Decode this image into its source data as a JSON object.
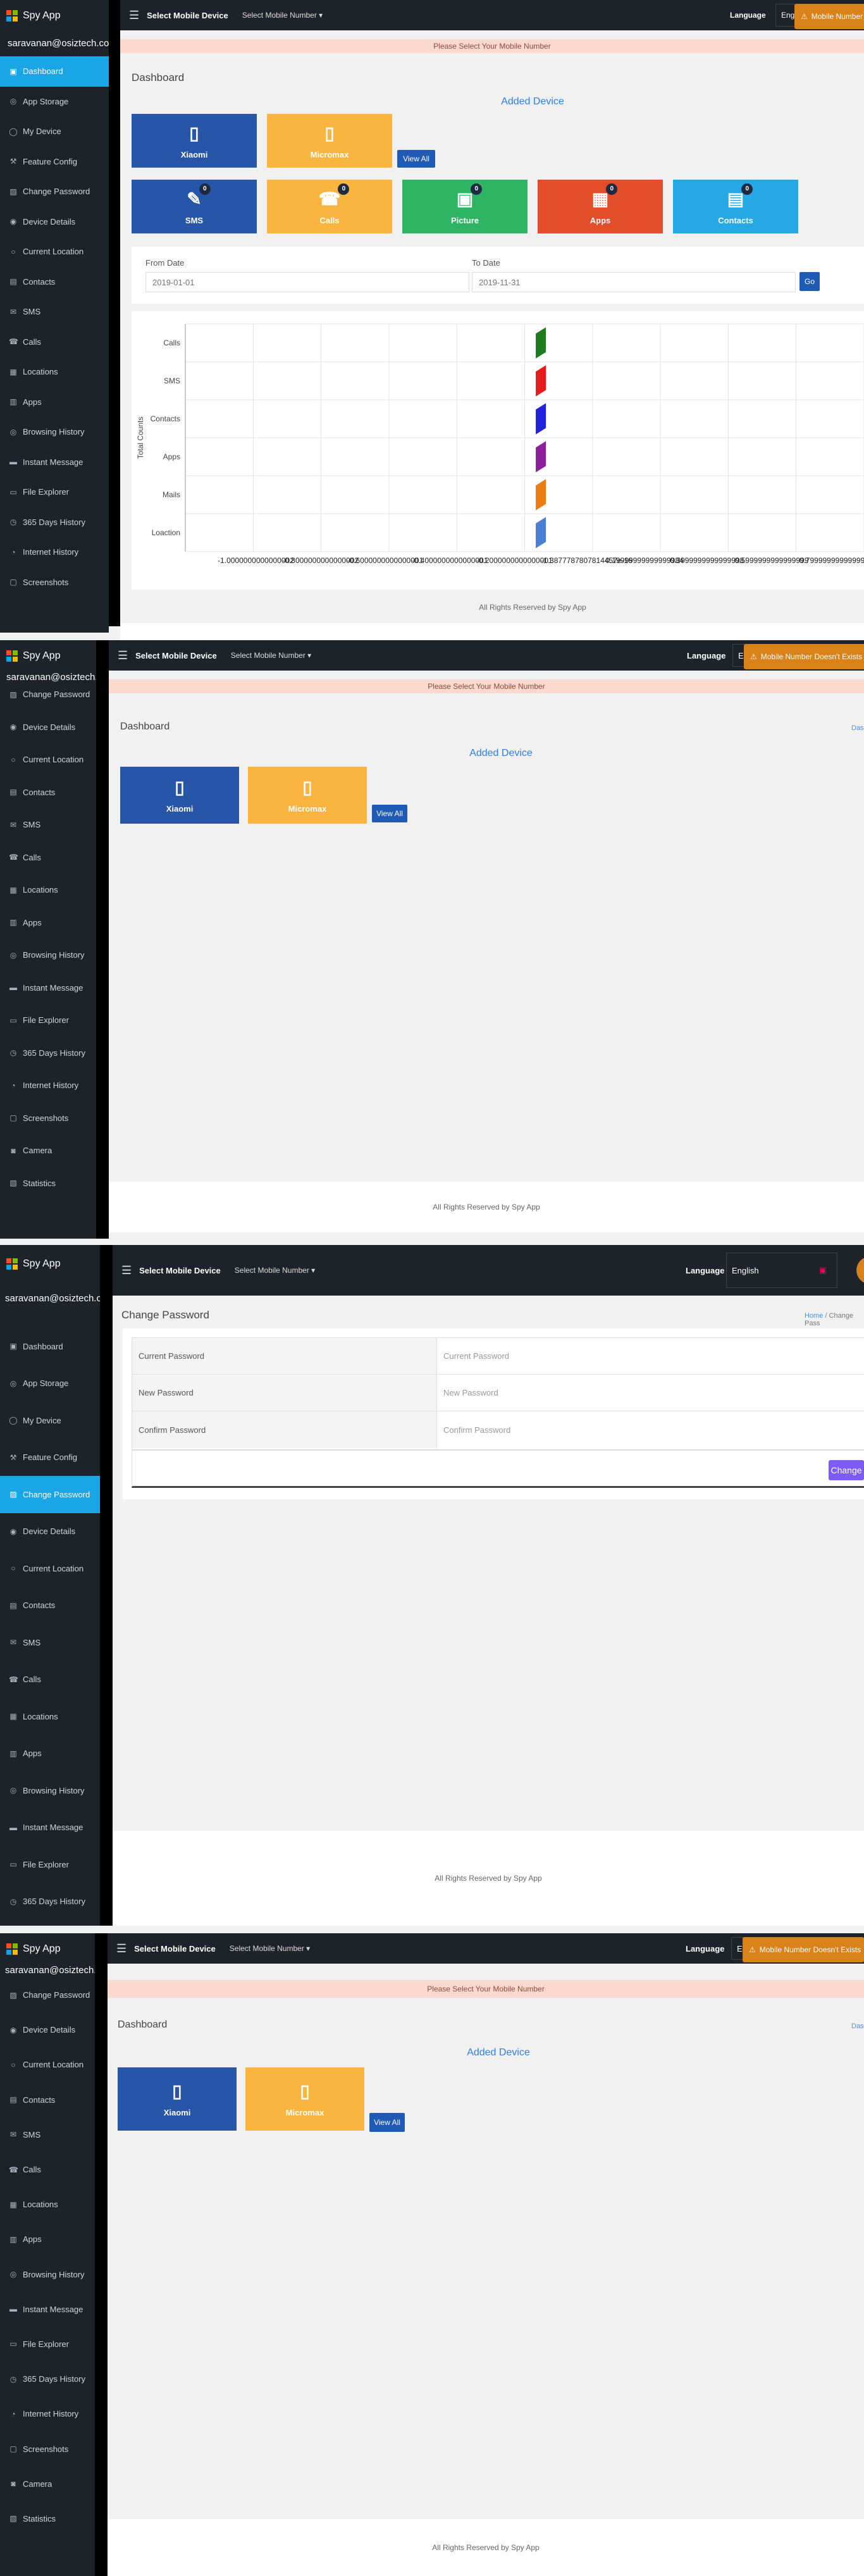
{
  "app": {
    "name": "Spy App",
    "email": "saravanan@osiztech.com",
    "footer": "All Rights Reserved by Spy App"
  },
  "topbar": {
    "menu_icon": "hamburger-icon",
    "title": "Select Mobile Device",
    "selector": "Select Mobile Number ▾",
    "language_label": "Language",
    "language_value": "English",
    "language_short": "Engl",
    "toast_1": "Mobile Number",
    "toast_2": "Mobile Number Doesn't Exists",
    "toast_icon": "warning-icon"
  },
  "alert": "Please Select Your Mobile Number",
  "nav_full": [
    {
      "label": "Dashboard",
      "icon": "dashboard-icon",
      "glyph": "▣"
    },
    {
      "label": "App Storage",
      "icon": "storage-icon",
      "glyph": "◎"
    },
    {
      "label": "My Device",
      "icon": "device-icon",
      "glyph": "◯"
    },
    {
      "label": "Feature Config",
      "icon": "wrench-icon",
      "glyph": "⚒"
    },
    {
      "label": "Change Password",
      "icon": "lock-icon",
      "glyph": "▨"
    },
    {
      "label": "Device Details",
      "icon": "info-icon",
      "glyph": "◉"
    },
    {
      "label": "Current Location",
      "icon": "location-icon",
      "glyph": "○"
    },
    {
      "label": "Contacts",
      "icon": "contacts-icon",
      "glyph": "▤"
    },
    {
      "label": "SMS",
      "icon": "sms-icon",
      "glyph": "✉"
    },
    {
      "label": "Calls",
      "icon": "phone-icon",
      "glyph": "☎"
    },
    {
      "label": "Locations",
      "icon": "map-icon",
      "glyph": "▦"
    },
    {
      "label": "Apps",
      "icon": "apps-icon",
      "glyph": "▥"
    },
    {
      "label": "Browsing History",
      "icon": "globe-icon",
      "glyph": "◎"
    },
    {
      "label": "Instant Message",
      "icon": "chat-icon",
      "glyph": "▬"
    },
    {
      "label": "File Explorer",
      "icon": "folder-icon",
      "glyph": "▭"
    },
    {
      "label": "365 Days History",
      "icon": "history-icon",
      "glyph": "◷"
    },
    {
      "label": "Internet History",
      "icon": "internet-icon",
      "glyph": "◔"
    },
    {
      "label": "Screenshots",
      "icon": "screenshot-icon",
      "glyph": "▢"
    }
  ],
  "nav_short": [
    {
      "label": "Change Password",
      "icon": "lock-icon",
      "glyph": "▨"
    },
    {
      "label": "Device Details",
      "icon": "info-icon",
      "glyph": "◉"
    },
    {
      "label": "Current Location",
      "icon": "location-icon",
      "glyph": "○"
    },
    {
      "label": "Contacts",
      "icon": "contacts-icon",
      "glyph": "▤"
    },
    {
      "label": "SMS",
      "icon": "sms-icon",
      "glyph": "✉"
    },
    {
      "label": "Calls",
      "icon": "phone-icon",
      "glyph": "☎"
    },
    {
      "label": "Locations",
      "icon": "map-icon",
      "glyph": "▦"
    },
    {
      "label": "Apps",
      "icon": "apps-icon",
      "glyph": "▥"
    },
    {
      "label": "Browsing History",
      "icon": "globe-icon",
      "glyph": "◎"
    },
    {
      "label": "Instant Message",
      "icon": "chat-icon",
      "glyph": "▬"
    },
    {
      "label": "File Explorer",
      "icon": "folder-icon",
      "glyph": "▭"
    },
    {
      "label": "365 Days History",
      "icon": "history-icon",
      "glyph": "◷"
    },
    {
      "label": "Internet History",
      "icon": "internet-icon",
      "glyph": "◔"
    },
    {
      "label": "Screenshots",
      "icon": "screenshot-icon",
      "glyph": "▢"
    },
    {
      "label": "Camera",
      "icon": "camera-icon",
      "glyph": "◙"
    },
    {
      "label": "Statistics",
      "icon": "stats-icon",
      "glyph": "▧"
    }
  ],
  "dashboard": {
    "title": "Dashboard",
    "added_device": "Added Device",
    "devices": [
      {
        "name": "Xiaomi",
        "icon": "phone-icon",
        "color": "#2756a8"
      },
      {
        "name": "Micromax",
        "icon": "phone-icon",
        "color": "#f9b540"
      }
    ],
    "view_all": "View All",
    "features": [
      {
        "name": "SMS",
        "icon": "sms-icon",
        "glyph": "✎",
        "count": "0",
        "color": "#2756a8"
      },
      {
        "name": "Calls",
        "icon": "phone-icon",
        "glyph": "☎",
        "count": "0",
        "color": "#f9b540"
      },
      {
        "name": "Picture",
        "icon": "picture-icon",
        "glyph": "▣",
        "count": "0",
        "color": "#2fb463"
      },
      {
        "name": "Apps",
        "icon": "apps-icon",
        "glyph": "▦",
        "count": "0",
        "color": "#e24d2a"
      },
      {
        "name": "Contacts",
        "icon": "contacts-icon",
        "glyph": "▤",
        "count": "0",
        "color": "#25a8e3"
      }
    ],
    "from_label": "From Date",
    "from_value": "2019-01-01",
    "to_label": "To Date",
    "to_value": "2019-11-31",
    "go": "Go",
    "cutoff_link": "Dash"
  },
  "chart_data": {
    "type": "bar",
    "categories": [
      "Calls",
      "SMS",
      "Contacts",
      "Apps",
      "Mails",
      "Loaction"
    ],
    "values": [
      0,
      0,
      0,
      0,
      0,
      0
    ],
    "colors": [
      "#1e7b1e",
      "#e41c1c",
      "#2222dd",
      "#8b1f9c",
      "#ec7c11",
      "#4a7fd6"
    ],
    "ylabel": "Total Counts",
    "xticks": [
      "-1.0000000000000002",
      "-0.8000000000000002",
      "-0.6000000000000001",
      "-0.4000000000000001",
      "-0.2000000000000001",
      "-1.3877787807814457e-16",
      "0.19999999999999984",
      "0.3999999999999998",
      "0.5999999999999999",
      "0.7999999999999999"
    ],
    "grid": true
  },
  "change_password": {
    "title": "Change Password",
    "crumb_home": "Home",
    "crumb_current": "Change Pass",
    "rows": [
      {
        "label": "Current Password",
        "placeholder": "Current Password"
      },
      {
        "label": "New Password",
        "placeholder": "New Password"
      },
      {
        "label": "Confirm Password",
        "placeholder": "Confirm Password"
      }
    ],
    "button": "Change"
  }
}
